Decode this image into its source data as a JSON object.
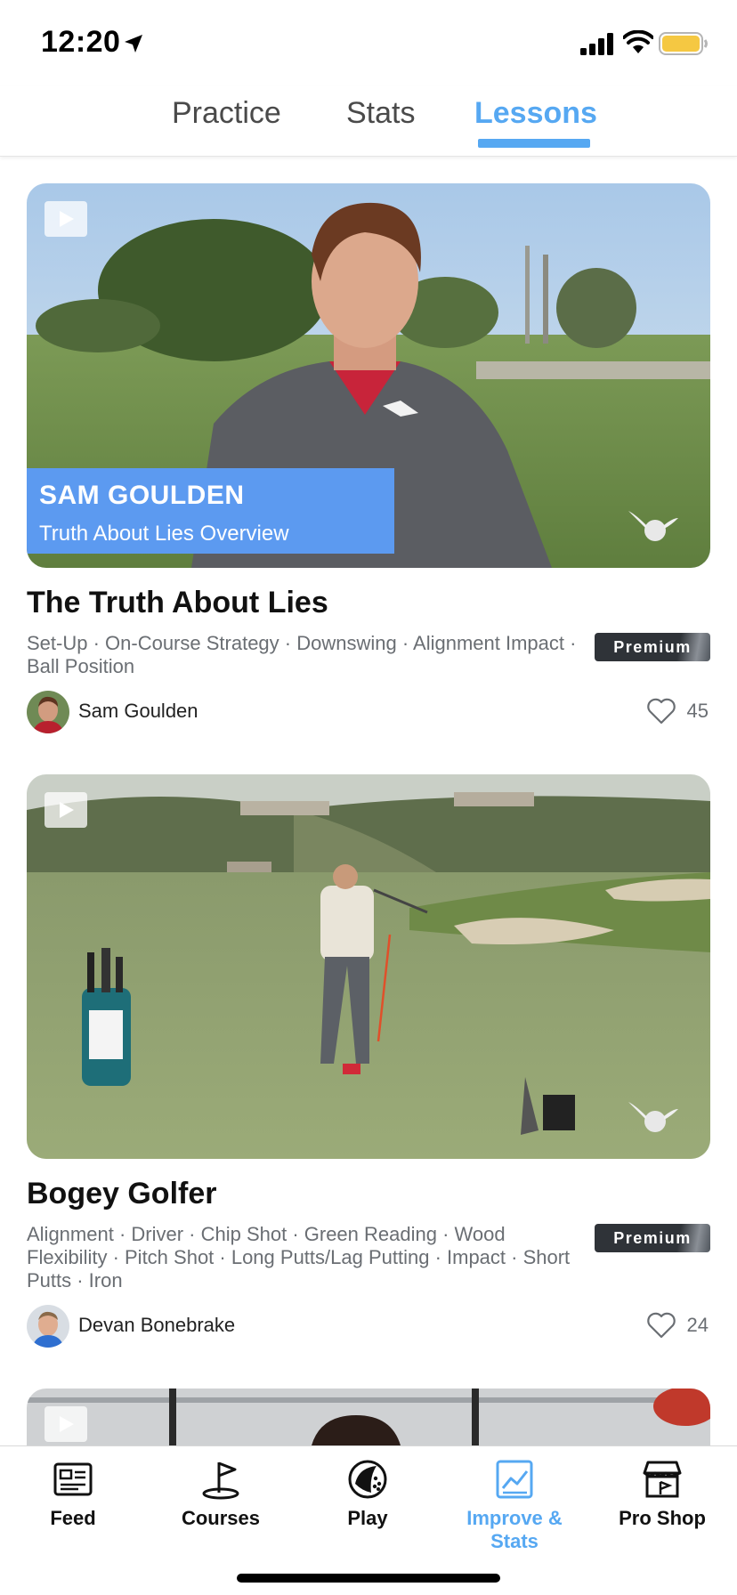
{
  "status_bar": {
    "time": "12:20"
  },
  "top_tabs": [
    {
      "label": "Practice",
      "active": false
    },
    {
      "label": "Stats",
      "active": false
    },
    {
      "label": "Lessons",
      "active": true
    }
  ],
  "lessons": [
    {
      "overlay_name": "SAM GOULDEN",
      "overlay_subtitle": "Truth About Lies Overview",
      "title": "The Truth About Lies",
      "tags": "Set-Up · On-Course Strategy · Downswing · Alignment Impact · Ball Position",
      "badge": "Premium",
      "author": "Sam Goulden",
      "likes": "45"
    },
    {
      "title": "Bogey Golfer",
      "tags": "Alignment · Driver · Chip Shot · Green Reading · Wood Flexibility · Pitch Shot · Long Putts/Lag Putting · Impact · Short Putts · Iron",
      "badge": "Premium",
      "author": "Devan Bonebrake",
      "likes": "24"
    }
  ],
  "bottom_nav": [
    {
      "label": "Feed",
      "icon": "feed-icon",
      "active": false
    },
    {
      "label": "Courses",
      "icon": "flag-icon",
      "active": false
    },
    {
      "label": "Play",
      "icon": "golf-ball-icon",
      "active": false
    },
    {
      "label": "Improve & Stats",
      "icon": "chart-icon",
      "active": true
    },
    {
      "label": "Pro Shop",
      "icon": "store-icon",
      "active": false
    }
  ],
  "colors": {
    "accent": "#56a8f2",
    "overlay_blue": "#5c9af0",
    "premium_bg": "#2f3338"
  }
}
